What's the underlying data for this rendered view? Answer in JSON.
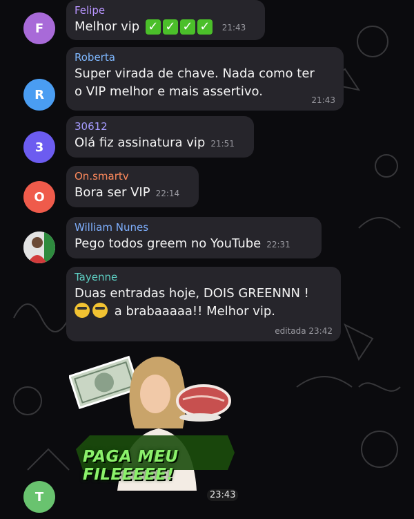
{
  "messages": [
    {
      "avatar_letter": "F",
      "avatar_color": "#a86ad8",
      "name": "Felipe",
      "name_color": "#b895ff",
      "text": "Melhor vip",
      "checks": [
        "✓",
        "✓",
        "✓",
        "✓"
      ],
      "time": "21:43"
    },
    {
      "avatar_letter": "R",
      "avatar_color": "#4a9df2",
      "name": "Roberta",
      "name_color": "#7fb8ff",
      "text_line1": "Super virada de chave. Nada como ter",
      "text_line2": "o VIP melhor e mais assertivo.",
      "time": "21:43"
    },
    {
      "avatar_letter": "3",
      "avatar_color": "#6c5cf0",
      "name": "30612",
      "name_color": "#a59bff",
      "text": "Olá fiz assinatura vip",
      "time": "21:51"
    },
    {
      "avatar_letter": "O",
      "avatar_color": "#ef5b4b",
      "name": "On.smartv",
      "name_color": "#ff8a5c",
      "text": "Bora ser VIP",
      "time": "22:14"
    },
    {
      "name": "William Nunes",
      "name_color": "#7fb0ff",
      "text": "Pego todos greem no YouTube",
      "time": "22:31"
    },
    {
      "name": "Tayenne",
      "name_color": "#5ed1c5",
      "text_line1": "Duas entradas hoje, DOIS GREENNN !",
      "text_line2": "a brabaaaaa!! Melhor vip.",
      "time": "editada 23:42"
    }
  ],
  "sticker": {
    "caption": "PAGA MEU FILEEEEE!",
    "time": "23:43",
    "avatar_letter": "T",
    "avatar_color": "#69c36f"
  }
}
